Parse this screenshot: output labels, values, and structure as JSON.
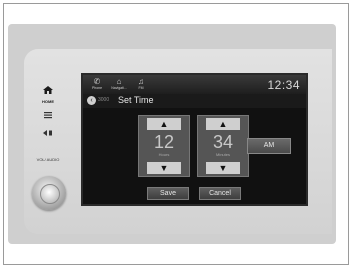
{
  "sidebar": {
    "home_label": "HOME",
    "volume_label": "VOL/\nAUDIO"
  },
  "topbar": {
    "items": [
      {
        "label": "Phone",
        "icon": "phone-icon"
      },
      {
        "label": "Navigati...",
        "icon": "navigation-icon"
      },
      {
        "label": "FM",
        "icon": "radio-icon"
      }
    ],
    "clock": "12:34"
  },
  "titlebar": {
    "crumb": "3000",
    "title": "Set Time"
  },
  "time": {
    "hours": "12",
    "hours_label": "Hours",
    "minutes": "34",
    "minutes_label": "Minutes",
    "separator": ":",
    "ampm": "AM"
  },
  "actions": {
    "save": "Save",
    "cancel": "Cancel"
  }
}
